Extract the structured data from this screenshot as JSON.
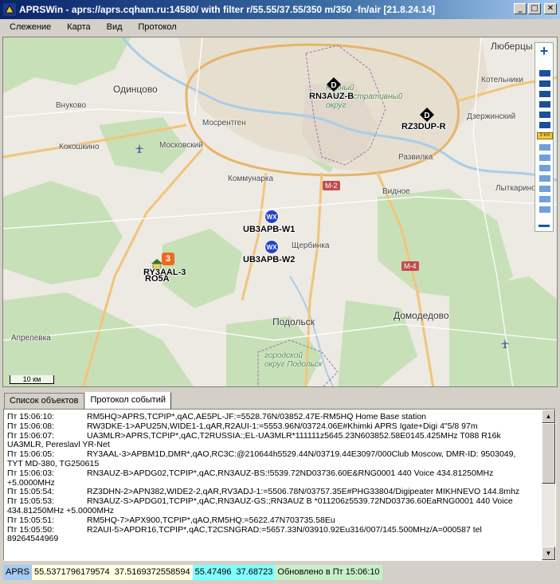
{
  "window": {
    "title": "APRSWin - aprs://aprs.cqham.ru:14580/ with filter r/55.55/37.55/350 m/350 -fn/air [21.8.24.14]",
    "minimize": "_",
    "maximize": "□",
    "close": "✕"
  },
  "menu": [
    "Слежение",
    "Карта",
    "Вид",
    "Протокол"
  ],
  "map": {
    "places": {
      "odintsovo": "Одинцово",
      "lyubertsy": "Люберцы",
      "kotelniki": "Котельники",
      "dzerzhinsky": "Дзержинский",
      "moskovsky": "Московский",
      "vnukovo": "Внуково",
      "kokoshkino": "Кокошкино",
      "mosrentgen": "Мосрентген",
      "kommunarka": "Коммунарка",
      "razvilka": "Развилка",
      "vidnoe": "Видное",
      "lytkarino": "Лыткарино",
      "shcherbinka": "Щербинка",
      "podolsk": "Подольск",
      "domodedovo": "Домодедово",
      "aprelevka": "Апрелевка",
      "south_okrug": "Южный административный округ",
      "south_okrug_1": "Южный",
      "south_okrug_2": "административный",
      "south_okrug_3": "округ",
      "podolsk_district": "городской округ Подольск",
      "podolsk_district_1": "городской",
      "podolsk_district_2": "округ Подольск"
    },
    "roads": [
      "М-2",
      "М-4"
    ],
    "scale_label": "10 км",
    "markers": [
      {
        "callsign": "RN3AUZ-B",
        "icon": "digipeater-d-icon",
        "symbol": "D"
      },
      {
        "callsign": "RZ3DUP-R",
        "icon": "digipeater-d-icon",
        "symbol": "D"
      },
      {
        "callsign": "UB3APB-W1",
        "icon": "weather-wx-icon",
        "symbol": "WX"
      },
      {
        "callsign": "UB3APB-W2",
        "icon": "weather-wx-icon",
        "symbol": "WX"
      },
      {
        "callsign": "RY3AAL-3",
        "icon": "house-icon",
        "symbol": ""
      },
      {
        "callsign": "RO5A",
        "icon": "house-icon",
        "symbol": ""
      }
    ],
    "cluster_count": "3",
    "zoom_plus": "+",
    "zoom_slider_label": "3 km"
  },
  "tabs": [
    "Список объектов",
    "Протокол событий"
  ],
  "log": [
    {
      "time": "Пт 15:06:10:",
      "msg": "RM5HQ>APRS,TCPIP*,qAC,AE5PL-JF:=5528.76N/03852.47E-RM5HQ Home Base station",
      "cont": ""
    },
    {
      "time": "Пт 15:06:08:",
      "msg": "RW3DKE-1>APU25N,WIDE1-1,qAR,R2AUI-1:=5553.96N/03724.06E#Khimki APRS Igate+Digi 4\"5/8  97m",
      "cont": ""
    },
    {
      "time": "Пт 15:06:07:",
      "msg": "UA3MLR>APRS,TCPIP*,qAC,T2RUSSIA:;EL-UA3MLR*111111z5645.23N603852.58E0145.425MHz T088 R16k",
      "cont": "UA3MLR, Pereslavl YR-Net"
    },
    {
      "time": "Пт 15:06:05:",
      "msg": "RY3AAL-3>APBM1D,DMR*,qAO,RC3C:@210644h5529.44N/03719.44E3097/000Club Moscow, DMR-ID: 9503049,",
      "cont": "TYT MD-380, TG250615"
    },
    {
      "time": "Пт 15:06:03:",
      "msg": "RN3AUZ-B>APDG02,TCPIP*,qAC,RN3AUZ-BS:!5539.72ND03736.60E&RNG0001 440 Voice 434.81250MHz",
      "cont": "+5.0000MHz"
    },
    {
      "time": "Пт 15:05:54:",
      "msg": "RZ3DHN-2>APN382,WIDE2-2,qAR,RV3ADJ-1:=5506.78N/03757.35E#PHG33804/Digipeater MIKHNEVO 144.8mhz",
      "cont": ""
    },
    {
      "time": "Пт 15:05:53:",
      "msg": "RN3AUZ-S>APDG01,TCPIP*,qAC,RN3AUZ-GS:;RN3AUZ B *011206z5539.72ND03736.60EaRNG0001 440 Voice",
      "cont": "434.81250MHz +5.0000MHz"
    },
    {
      "time": "Пт 15:05:51:",
      "msg": "RM5HQ-7>APX900,TCPIP*,qAO,RM5HQ:=5622.47N703735.58Eu",
      "cont": ""
    },
    {
      "time": "Пт 15:05:50:",
      "msg": "R2AUI-5>APDR16,TCPIP*,qAC,T2CSNGRAD:=5657.33N/03910.92Eu316/007/145.500MHz/A=000587 tel",
      "cont": "89264544969"
    }
  ],
  "status": {
    "mode": "APRS",
    "lat": "55.5371796179574",
    "lon": "37.5169372558594",
    "center_lat": "55.47496",
    "center_lon": "37.68723",
    "updated": "Обновлено в Пт 15:06:10"
  },
  "colors": {
    "title_start": "#0a246a",
    "title_end": "#a6caf0",
    "status_mode_bg": "#a6caf0",
    "status_coord_bg": "#ffffe1",
    "status_center_bg": "#80ffff",
    "status_updated_bg": "#c8f0c8"
  }
}
